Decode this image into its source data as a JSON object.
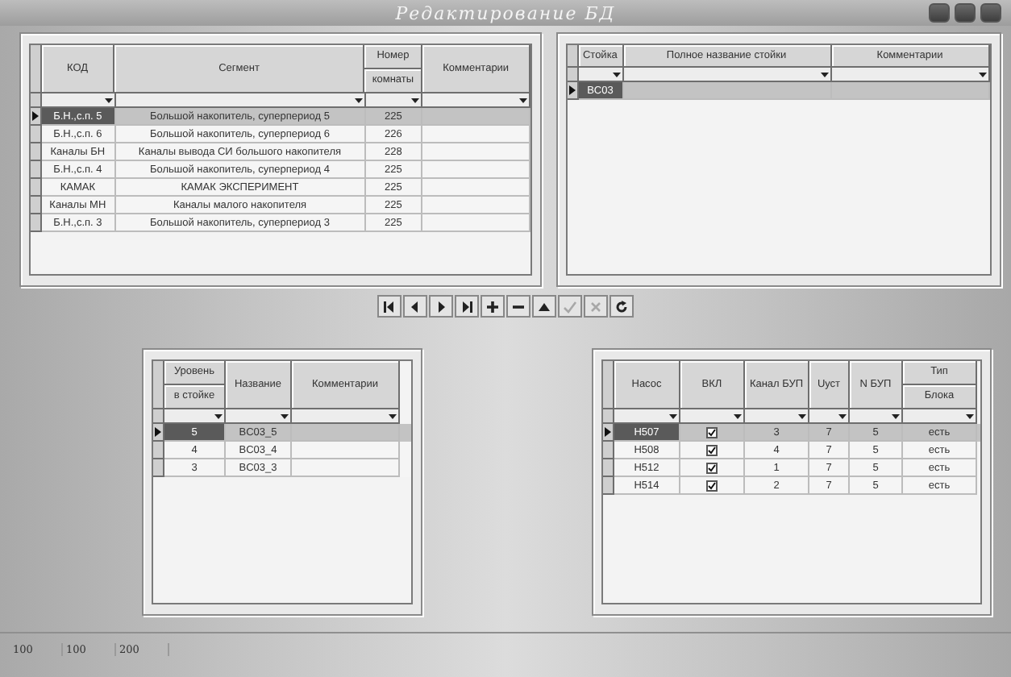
{
  "window": {
    "title": "Редактирование БД"
  },
  "segments": {
    "columns": [
      {
        "lines": [
          "КОД"
        ]
      },
      {
        "lines": [
          "Сегмент"
        ]
      },
      {
        "lines": [
          "Номер",
          "комнаты"
        ]
      },
      {
        "lines": [
          "Комментарии"
        ]
      }
    ],
    "rows": [
      {
        "selected": true,
        "cells": [
          "Б.Н.,с.п. 5",
          "Большой накопитель, суперпериод 5",
          "225",
          ""
        ]
      },
      {
        "selected": false,
        "cells": [
          "Б.Н.,с.п. 6",
          "Большой накопитель, суперпериод 6",
          "226",
          ""
        ]
      },
      {
        "selected": false,
        "cells": [
          "Каналы БН",
          "Каналы вывода СИ большого накопителя",
          "228",
          ""
        ]
      },
      {
        "selected": false,
        "cells": [
          "Б.Н.,с.п. 4",
          "Большой накопитель, суперпериод 4",
          "225",
          ""
        ]
      },
      {
        "selected": false,
        "cells": [
          "КАМАК",
          "КАМАК ЭКСПЕРИМЕНТ",
          "225",
          ""
        ]
      },
      {
        "selected": false,
        "cells": [
          "Каналы МН",
          "Каналы малого накопителя",
          "225",
          ""
        ]
      },
      {
        "selected": false,
        "cells": [
          "Б.Н.,с.п. 3",
          "Большой накопитель, суперпериод 3",
          "225",
          ""
        ]
      }
    ]
  },
  "racks": {
    "columns": [
      {
        "lines": [
          "Стойка"
        ]
      },
      {
        "lines": [
          "Полное название стойки"
        ]
      },
      {
        "lines": [
          "Комментарии"
        ]
      }
    ],
    "rows": [
      {
        "selected": true,
        "cells": [
          "BC03",
          "",
          ""
        ]
      }
    ]
  },
  "nav_buttons": [
    {
      "kind": "first",
      "disabled": false
    },
    {
      "kind": "prior",
      "disabled": false
    },
    {
      "kind": "next",
      "disabled": false
    },
    {
      "kind": "last",
      "disabled": false
    },
    {
      "kind": "insert",
      "disabled": false
    },
    {
      "kind": "delete",
      "disabled": false
    },
    {
      "kind": "edit",
      "disabled": false
    },
    {
      "kind": "post",
      "disabled": true
    },
    {
      "kind": "cancel",
      "disabled": true
    },
    {
      "kind": "refresh",
      "disabled": false
    }
  ],
  "levels": {
    "columns": [
      {
        "lines": [
          "Уровень",
          "в стойке"
        ]
      },
      {
        "lines": [
          "Название"
        ]
      },
      {
        "lines": [
          "Комментарии"
        ]
      }
    ],
    "rows": [
      {
        "selected": true,
        "cells": [
          "5",
          "BC03_5",
          ""
        ]
      },
      {
        "selected": false,
        "cells": [
          "4",
          "BC03_4",
          ""
        ]
      },
      {
        "selected": false,
        "cells": [
          "3",
          "BC03_3",
          ""
        ]
      }
    ]
  },
  "pumps": {
    "columns": [
      {
        "lines": [
          "Насос"
        ]
      },
      {
        "lines": [
          "ВКЛ"
        ]
      },
      {
        "lines": [
          "Канал БУП"
        ]
      },
      {
        "lines": [
          "Uуст"
        ]
      },
      {
        "lines": [
          "N БУП"
        ]
      },
      {
        "lines": [
          "Тип",
          "Блока"
        ]
      }
    ],
    "rows": [
      {
        "selected": true,
        "cells": [
          {
            "kind": "text",
            "text": "H507"
          },
          {
            "kind": "check",
            "checked": true
          },
          {
            "kind": "text",
            "text": "3"
          },
          {
            "kind": "text",
            "text": "7"
          },
          {
            "kind": "text",
            "text": "5"
          },
          {
            "kind": "text",
            "text": "есть"
          }
        ]
      },
      {
        "selected": false,
        "cells": [
          {
            "kind": "text",
            "text": "H508"
          },
          {
            "kind": "check",
            "checked": true
          },
          {
            "kind": "text",
            "text": "4"
          },
          {
            "kind": "text",
            "text": "7"
          },
          {
            "kind": "text",
            "text": "5"
          },
          {
            "kind": "text",
            "text": "есть"
          }
        ]
      },
      {
        "selected": false,
        "cells": [
          {
            "kind": "text",
            "text": "H512"
          },
          {
            "kind": "check",
            "checked": true
          },
          {
            "kind": "text",
            "text": "1"
          },
          {
            "kind": "text",
            "text": "7"
          },
          {
            "kind": "text",
            "text": "5"
          },
          {
            "kind": "text",
            "text": "есть"
          }
        ]
      },
      {
        "selected": false,
        "cells": [
          {
            "kind": "text",
            "text": "H514"
          },
          {
            "kind": "check",
            "checked": true
          },
          {
            "kind": "text",
            "text": "2"
          },
          {
            "kind": "text",
            "text": "7"
          },
          {
            "kind": "text",
            "text": "5"
          },
          {
            "kind": "text",
            "text": "есть"
          }
        ]
      }
    ]
  },
  "status_bar": [
    "100",
    "100",
    "200"
  ]
}
